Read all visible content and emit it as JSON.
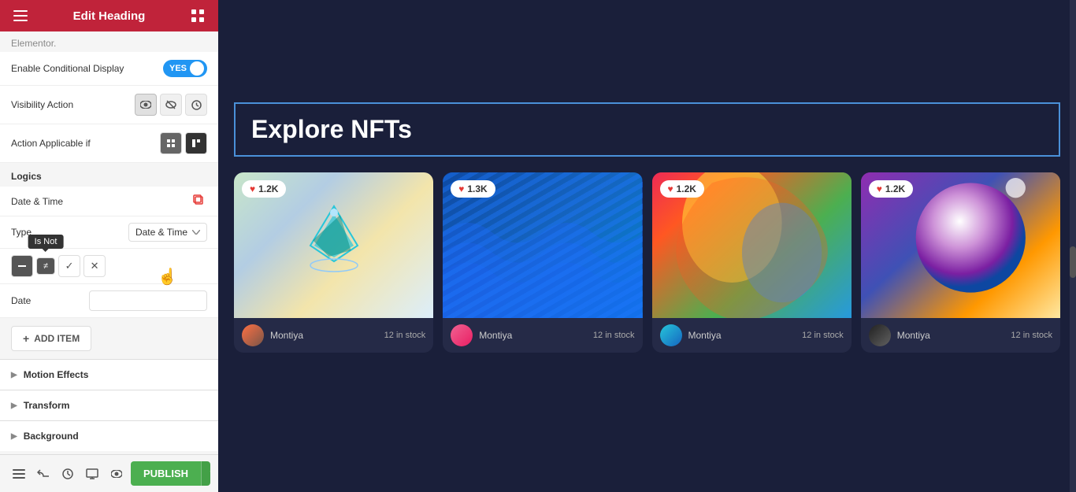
{
  "header": {
    "title": "Edit Heading",
    "menu_icon": "≡",
    "grid_icon": "⊞"
  },
  "panel": {
    "elementor_label": "Elementor.",
    "enable_conditional_display_label": "Enable Conditional Display",
    "toggle_yes": "YES",
    "visibility_action_label": "Visibility Action",
    "visibility_icons": [
      "👁",
      "🚫",
      "⏱"
    ],
    "action_applicable_label": "Action Applicable if",
    "logics_label": "Logics",
    "date_time_label": "Date & Time",
    "type_label": "Type",
    "type_value": "Date & Time",
    "is_not_tooltip": "Is Not",
    "date_label": "Date",
    "date_placeholder": "",
    "add_item_label": "ADD ITEM",
    "motion_effects_label": "Motion Effects",
    "transform_label": "Transform",
    "background_label": "Background"
  },
  "toolbar": {
    "hamburger_icon": "☰",
    "history_icon": "↺",
    "responsive_icon": "⊡",
    "eye_icon": "👁",
    "publish_label": "PUBLISH",
    "arrow_down": "▼"
  },
  "main": {
    "heading_text": "Explore NFTs",
    "cards": [
      {
        "likes": "1.2K",
        "artist": "Montiya",
        "stock": "12 in stock"
      },
      {
        "likes": "1.3K",
        "artist": "Montiya",
        "stock": "12 in stock"
      },
      {
        "likes": "1.2K",
        "artist": "Montiya",
        "stock": "12 in stock"
      },
      {
        "likes": "1.2K",
        "artist": "Montiya",
        "stock": "12 in stock"
      }
    ]
  }
}
